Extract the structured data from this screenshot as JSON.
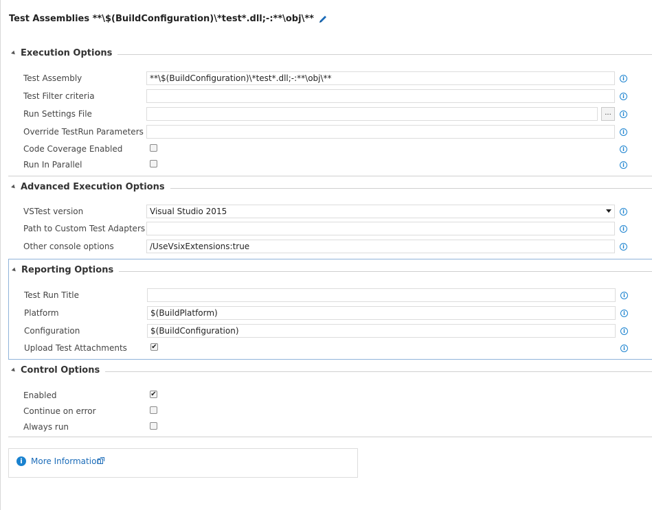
{
  "header": {
    "title": "Test Assemblies **\\$(BuildConfiguration)\\*test*.dll;-:**\\obj\\**"
  },
  "sections": {
    "execution": {
      "title": "Execution Options",
      "rows": [
        {
          "label": "Test Assembly",
          "value": "**\\$(BuildConfiguration)\\*test*.dll;-:**\\obj\\**"
        },
        {
          "label": "Test Filter criteria",
          "value": ""
        },
        {
          "label": "Run Settings File",
          "value": "",
          "browse": "..."
        },
        {
          "label": "Override TestRun Parameters",
          "value": ""
        },
        {
          "label": "Code Coverage Enabled",
          "checked": false
        },
        {
          "label": "Run In Parallel",
          "checked": false
        }
      ]
    },
    "advanced": {
      "title": "Advanced Execution Options",
      "rows": [
        {
          "label": "VSTest version",
          "value": "Visual Studio 2015"
        },
        {
          "label": "Path to Custom Test Adapters",
          "value": ""
        },
        {
          "label": "Other console options",
          "value": "/UseVsixExtensions:true"
        }
      ]
    },
    "reporting": {
      "title": "Reporting Options",
      "rows": [
        {
          "label": "Test Run Title",
          "value": ""
        },
        {
          "label": "Platform",
          "value": "$(BuildPlatform)"
        },
        {
          "label": "Configuration",
          "value": "$(BuildConfiguration)"
        },
        {
          "label": "Upload Test Attachments",
          "checked": true
        }
      ]
    },
    "control": {
      "title": "Control Options",
      "rows": [
        {
          "label": "Enabled",
          "checked": true
        },
        {
          "label": "Continue on error",
          "checked": false
        },
        {
          "label": "Always run",
          "checked": false
        }
      ]
    }
  },
  "more_info": {
    "label": "More Information"
  },
  "colors": {
    "accent": "#1a82cf",
    "link": "#1a6bb8",
    "focus_border": "#8fb3d9"
  },
  "icons": {
    "edit": "pencil-icon",
    "info": "info-icon",
    "external": "external-link-icon",
    "collapse": "collapse-triangle-icon"
  }
}
